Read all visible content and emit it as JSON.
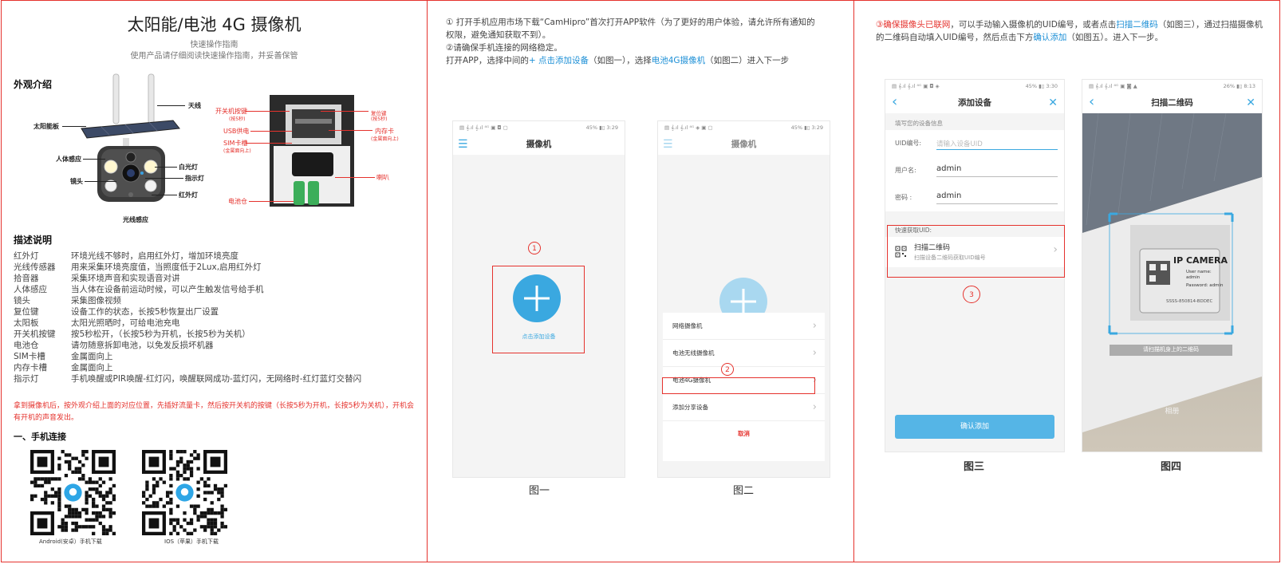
{
  "panel1": {
    "title": "太阳能/电池 4G 摄像机",
    "subtitle1": "快速操作指南",
    "subtitle2": "使用产品请仔细阅读快速操作指南，并妥善保管",
    "appearance_heading": "外观介绍",
    "camera_labels": {
      "antenna": "天线",
      "solar_panel": "太阳能板",
      "pir": "人体感应",
      "white_light": "白光灯",
      "indicator": "指示灯",
      "lens": "镜头",
      "ir_light": "红外灯",
      "light_sensor": "光线感应"
    },
    "inside_labels": {
      "power_button": "开关机按键",
      "power_button_note": "(按5秒)",
      "reset": "复位键",
      "reset_note": "(按5秒)",
      "usb": "USB供电",
      "sd": "内存卡",
      "sd_note": "(金属面向上)",
      "sim": "SIM卡槽",
      "sim_note": "(金属面向上)",
      "speaker": "喇叭",
      "battery": "电池仓"
    },
    "desc_heading": "描述说明",
    "desc_rows": [
      {
        "k": "红外灯",
        "v": "环境光线不够时，启用红外灯，增加环境亮度"
      },
      {
        "k": "光线传感器",
        "v": "用来采集环境亮度值，当照度低于2Lux,启用红外灯"
      },
      {
        "k": "拾音器",
        "v": "采集环境声音和实现语音对讲"
      },
      {
        "k": "人体感应",
        "v": "当人体在设备前运动时候，可以产生触发信号给手机"
      },
      {
        "k": "镜头",
        "v": "采集图像视频"
      },
      {
        "k": "复位键",
        "v": "设备工作的状态，长按5秒恢复出厂设置"
      },
      {
        "k": "太阳板",
        "v": "太阳光照晒时，可给电池充电"
      },
      {
        "k": "开关机按键",
        "v": "按5秒松开，（长按5秒为开机，长按5秒为关机）"
      },
      {
        "k": "电池仓",
        "v": "请勿随意拆卸电池，以免发反损坏机器"
      },
      {
        "k": "SIM卡槽",
        "v": "金属面向上"
      },
      {
        "k": "内存卡槽",
        "v": "金属面向上"
      },
      {
        "k": "指示灯",
        "v": "手机唤醒或PIR唤醒-红灯闪，唤醒联网成功-蓝灯闪，无网络时-红灯蓝灯交替闪"
      }
    ],
    "warning": "拿到摄像机后，按外观介绍上面的对应位置，先插好流量卡，然后按开关机的按键（长按5秒为开机，长按5秒为关机），开机会有开机的声音发出。",
    "connect_heading": "一、手机连接",
    "qr_android": "Android(安卓）手机下载",
    "qr_ios": "IOS（苹果）手机下载"
  },
  "panel2": {
    "step1": "① 打开手机应用市场下载“CamHipro”首次打开APP软件（为了更好的用户体验，请允许所有通知的权限，避免通知获取不到）。",
    "step2": "②请确保手机连接的网络稳定。",
    "step3_pre": "打开APP，选择中间的",
    "step3_link1": "+ 点击添加设备",
    "step3_mid": "（如图一），选择",
    "step3_link2": "电池4G摄像机",
    "step3_post": "（如图二）进入下一步",
    "phone1": {
      "status_left": "▤ 𝄞.ıl 𝄞.ıl ⁴ᴳ ▣ ◘ ▢",
      "status_right": "45% ▮▯ 3:29",
      "nav_title": "摄像机",
      "add_label": "点击添加设备",
      "marker": "1"
    },
    "phone2": {
      "status_left": "▤ 𝄞.ıl 𝄞.ıl ⁴ᴳ ◈ ▣ ▢",
      "status_right": "45% ▮▯ 3:29",
      "nav_title": "摄像机",
      "menu": [
        "网络摄像机",
        "电池无线摄像机",
        "电池4G摄像机",
        "添加分享设备"
      ],
      "cancel": "取消",
      "marker": "2"
    },
    "caption1": "图一",
    "caption2": "图二"
  },
  "panel3": {
    "intro_red": "③确保摄像头已联网",
    "intro_1": "，可以手动输入摄像机的UID编号，或者点击",
    "intro_link1": "扫描二维码",
    "intro_2": "（如图三），通过扫描摄像机的二维码自动填入UID编号，然后点击下方",
    "intro_link2": "确认添加",
    "intro_3": "（如图五）。进入下一步。",
    "phone3": {
      "status_left": "▤ 𝄞.ıl 𝄞.ıl ⁴ᴳ ▣ ◘ ◈",
      "status_right": "45% ▮▯ 3:30",
      "nav_title": "添加设备",
      "section": "填写您的设备信息",
      "uid_label": "UID编号:",
      "uid_placeholder": "请输入设备UID",
      "user_label": "用户名:",
      "user_value": "admin",
      "pwd_label": "密码 :",
      "pwd_value": "admin",
      "quick": "快速获取UID:",
      "scan_title": "扫描二维码",
      "scan_sub": "扫描设备二维码获取UID编号",
      "confirm": "确认添加",
      "marker": "3"
    },
    "phone4": {
      "status_left": "▤ 𝄞.ıl 𝄞.ıl ⁴ᴳ ▣ ◙ ▲",
      "status_right": "26% ▮▯ 8:13",
      "nav_title": "扫描二维码",
      "sticker_title": "IP CAMERA",
      "sticker_user": "User name: admin",
      "sticker_pwd": "Password: admin",
      "sticker_id": "SSSS-850814-BDDEC",
      "hint": "请扫描机身上的二维码",
      "album": "相册"
    },
    "caption3": "图三",
    "caption4": "图四"
  }
}
